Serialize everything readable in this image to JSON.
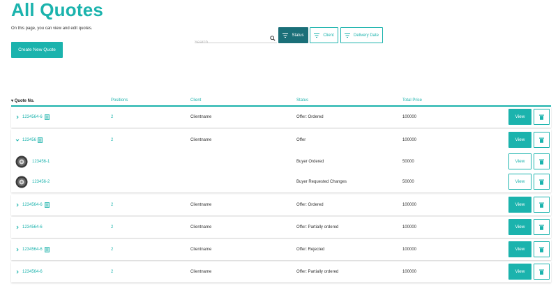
{
  "header": {
    "title": "All Quotes",
    "subtitle": "On this page, you can view and edit quotes.",
    "create_label": "Create New Quote"
  },
  "search": {
    "placeholder": "Search",
    "value": ""
  },
  "filters": [
    {
      "label": "Status",
      "active": true
    },
    {
      "label": "Client",
      "active": false
    },
    {
      "label": "Delivery Date",
      "active": false
    }
  ],
  "table": {
    "columns": [
      "Quote No.",
      "Positions",
      "Client",
      "Status",
      "Total Price"
    ],
    "view_label": "View",
    "rows": [
      {
        "quote_no": "1234564-6",
        "positions": "2",
        "client": "Clientname",
        "status": "Offer: Ordered",
        "total": "100000"
      },
      {
        "quote_no": "123456",
        "positions": "2",
        "client": "Clientname",
        "status": "Offer",
        "total": "100000",
        "expanded": true,
        "children": [
          {
            "quote_no": "123456-1",
            "status": "Buyer Ordered",
            "total": "50000"
          },
          {
            "quote_no": "123456-2",
            "status": "Buyer Requested Changes",
            "total": "50000"
          }
        ]
      },
      {
        "quote_no": "1234564-6",
        "positions": "2",
        "client": "Clientname",
        "status": "Offer: Ordered",
        "total": "100000"
      },
      {
        "quote_no": "1234564-6",
        "positions": "2",
        "client": "Clientname",
        "status": "Offer: Partially ordered",
        "total": "100000"
      },
      {
        "quote_no": "1234564-6",
        "positions": "2",
        "client": "Clientname",
        "status": "Offer: Rejected",
        "total": "100000"
      },
      {
        "quote_no": "1234564-6",
        "positions": "2",
        "client": "Clientname",
        "status": "Offer: Partially ordered",
        "total": "100000"
      }
    ]
  },
  "colors": {
    "accent": "#1bb3ad",
    "active_filter": "#1a6f78"
  },
  "icons": [
    "search-icon",
    "filter-icon",
    "chevron-right-icon",
    "chevron-down-icon",
    "document-icon",
    "trash-icon",
    "tire-icon"
  ]
}
